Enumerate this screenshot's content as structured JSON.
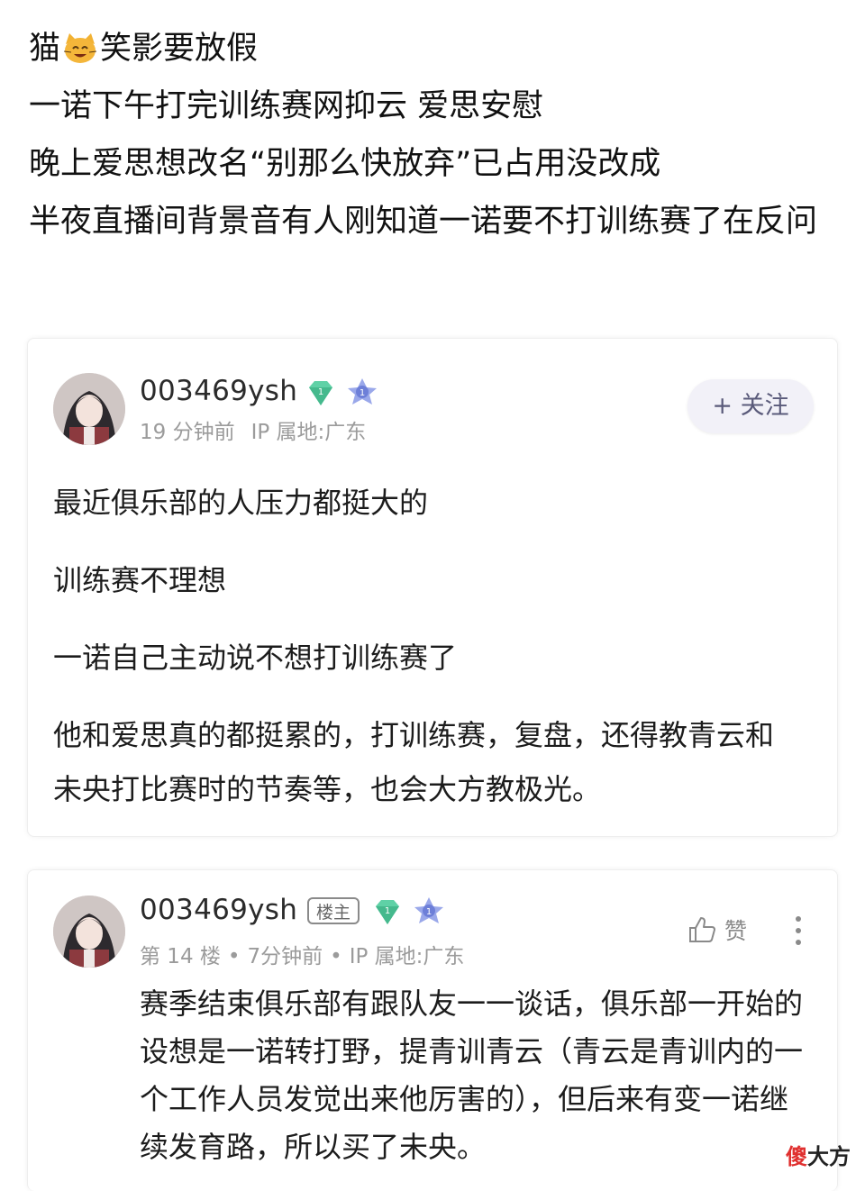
{
  "header": {
    "line1_before": "猫",
    "line1_after": "笑影要放假",
    "line2": "一诺下午打完训练赛网抑云 爱思安慰",
    "line3": "晚上爱思想改名“别那么快放弃”已占用没改成",
    "line4": "半夜直播间背景音有人刚知道一诺要不打训练赛了在反问"
  },
  "post": {
    "username": "003469ysh",
    "time": "19 分钟前",
    "ip": "IP 属地:广东",
    "follow_label": "+ 关注",
    "paragraphs": [
      "最近俱乐部的人压力都挺大的",
      "训练赛不理想",
      "一诺自己主动说不想打训练赛了",
      "他和爱思真的都挺累的，打训练赛，复盘，还得教青云和未央打比赛时的节奏等，也会大方教极光。"
    ]
  },
  "reply": {
    "username": "003469ysh",
    "owner_tag": "楼主",
    "floor": "第 14 楼",
    "time": "7分钟前",
    "ip": "IP 属地:广东",
    "like_label": "赞",
    "text": "赛季结束俱乐部有跟队友一一谈话，俱乐部一开始的设想是一诺转打野，提青训青云（青云是青训内的一个工作人员发觉出来他厉害的），但后来有变一诺继续发育路，所以买了未央。"
  },
  "watermark": {
    "red": "傻",
    "dark": "大方"
  },
  "colors": {
    "gem": "#5fd1a6",
    "star": "#6d7fd8",
    "follow_bg": "#f2f1f8",
    "meta_text": "#9b9b9b",
    "watermark_red": "#e0302f"
  }
}
